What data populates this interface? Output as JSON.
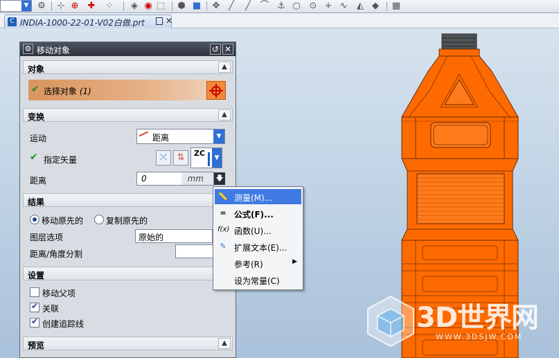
{
  "file_tab": {
    "name": "INDIA-1000-22-01-V02白做.prt",
    "close": "✕"
  },
  "dialog": {
    "title": "移动对象",
    "sections": {
      "object": "对象",
      "transform": "变换",
      "result": "结果",
      "settings": "设置",
      "preview": "预览"
    },
    "select_object": {
      "label": "选择对象",
      "count": "(1)"
    },
    "motion": {
      "label": "运动",
      "value": "距离"
    },
    "vector": {
      "label": "指定矢量",
      "axis": "ZC"
    },
    "distance": {
      "label": "距离",
      "value": "0",
      "unit": "mm"
    },
    "result": {
      "move_original": "移动原先的",
      "copy_original": "复制原先的",
      "layer_option_label": "图层选项",
      "layer_option_value": "原始的",
      "distance_angle_split": "距离/角度分割"
    },
    "settings": {
      "move_parent": "移动父项",
      "associative": "关联",
      "create_trace": "创建追踪线"
    }
  },
  "context_menu": {
    "items": [
      {
        "label": "测量(M)...",
        "highlighted": true
      },
      {
        "label": "公式(F)...",
        "bold": true
      },
      {
        "label": "函数(U)..."
      },
      {
        "label": "扩展文本(E)..."
      },
      {
        "label": "参考(R)",
        "submenu": true
      },
      {
        "label": "设为常量(C)"
      }
    ]
  },
  "watermark": {
    "brand": "3D世界网",
    "url": "WWW.3DSJW.COM"
  },
  "colors": {
    "bottle": "#ff6a00",
    "selection": "#e6a06a",
    "accent": "#2f6fd6"
  }
}
